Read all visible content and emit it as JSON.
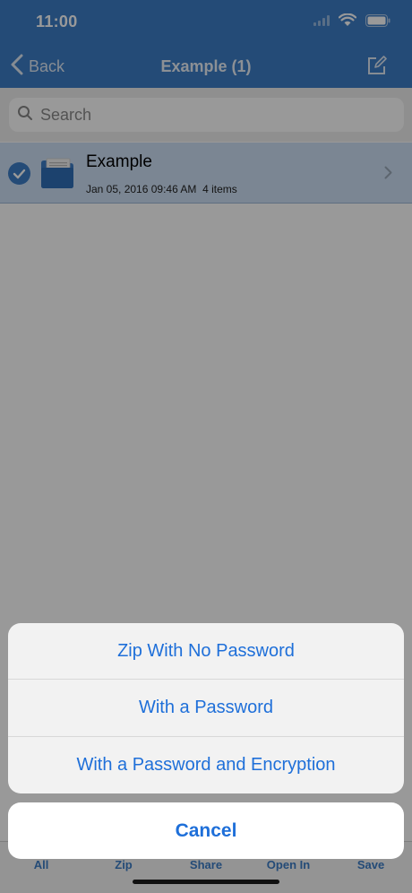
{
  "status_bar": {
    "time": "11:00"
  },
  "nav_bar": {
    "back_label": "Back",
    "title": "Example (1)"
  },
  "search": {
    "placeholder": "Search"
  },
  "file_list": [
    {
      "name": "Example",
      "meta": "Jan 05, 2016 09:46 AM  4 items",
      "selected": true
    }
  ],
  "toolbar": {
    "items": [
      "All",
      "Zip",
      "Share",
      "Open In",
      "Save"
    ]
  },
  "action_sheet": {
    "options": [
      "Zip With No Password",
      "With a Password",
      "With a Password and Encryption"
    ],
    "cancel_label": "Cancel"
  },
  "colors": {
    "accent": "#3c7dc7",
    "action_text": "#1e6fd9",
    "selected_row": "#cde0f6"
  }
}
